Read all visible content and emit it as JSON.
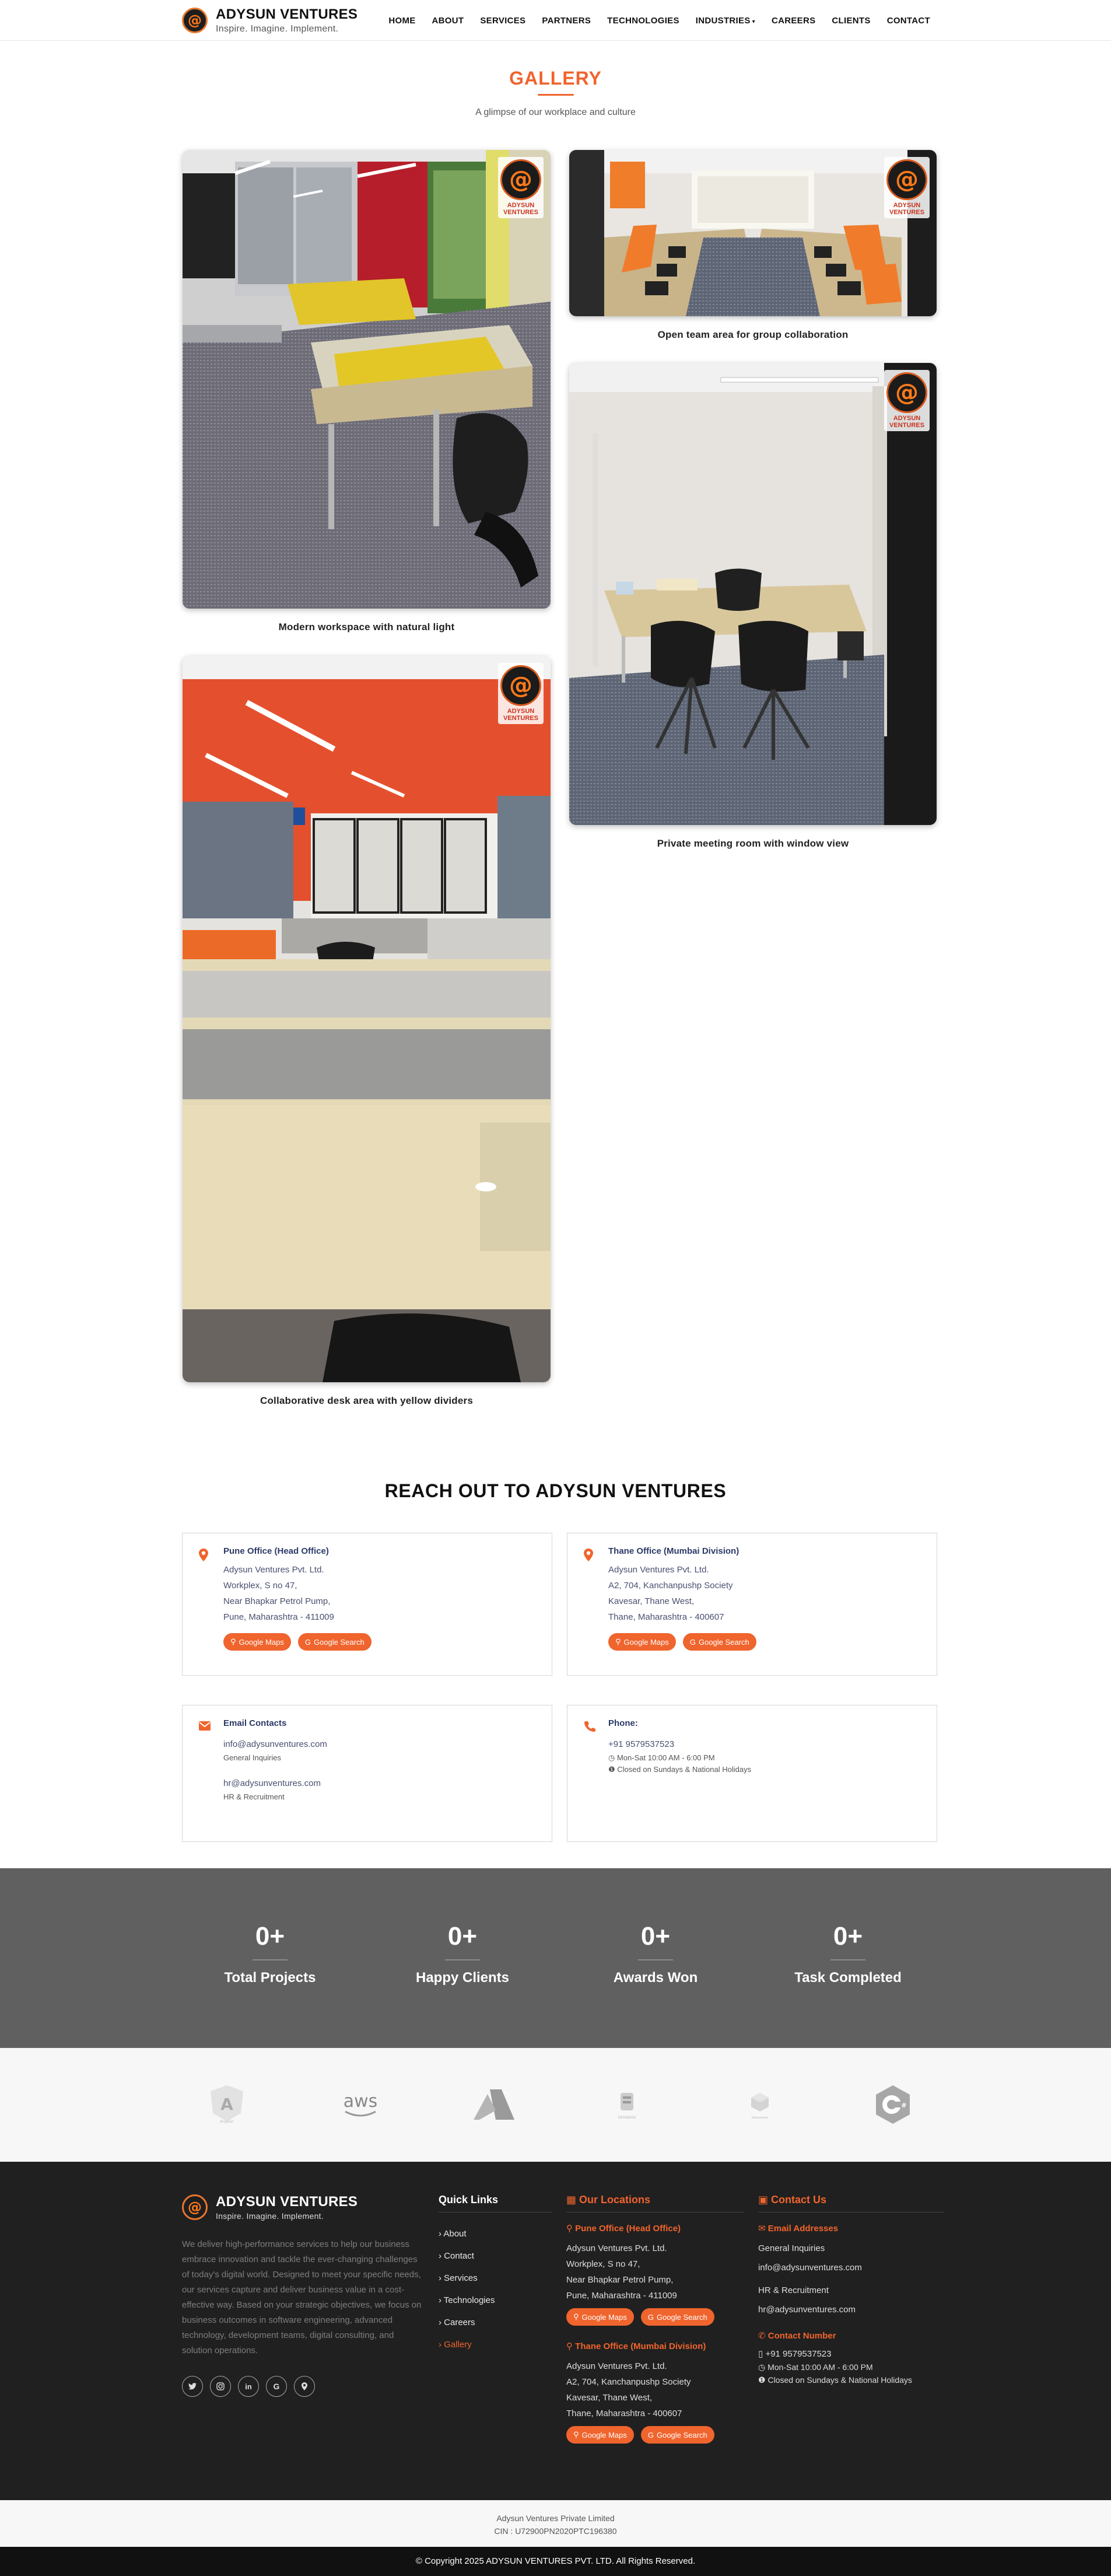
{
  "brand": {
    "name": "ADYSUN VENTURES",
    "tagline": "Inspire. Imagine. Implement.",
    "logo_glyph": "@"
  },
  "nav": [
    {
      "label": "HOME"
    },
    {
      "label": "ABOUT"
    },
    {
      "label": "SERVICES"
    },
    {
      "label": "PARTNERS"
    },
    {
      "label": "TECHNOLOGIES"
    },
    {
      "label": "INDUSTRIES",
      "dropdown": true
    },
    {
      "label": "CAREERS"
    },
    {
      "label": "CLIENTS"
    },
    {
      "label": "CONTACT"
    }
  ],
  "gallery": {
    "title": "GALLERY",
    "subtitle": "A glimpse of our workplace and culture",
    "badge_text": "ADYSUN\nVENTURES",
    "items": [
      {
        "caption": "Modern workspace with natural light"
      },
      {
        "caption": "Open team area for group collaboration"
      },
      {
        "caption": "Collaborative desk area with yellow dividers"
      },
      {
        "caption": "Private meeting room with window view"
      }
    ]
  },
  "reach": {
    "title": "REACH OUT TO ADYSUN VENTURES",
    "pune": {
      "title": "Pune Office (Head Office)",
      "lines": [
        "Adysun Ventures Pvt. Ltd.",
        "Workplex, S no 47,",
        "Near Bhapkar Petrol Pump,",
        "Pune, Maharashtra - 411009"
      ],
      "maps": "Google Maps",
      "search": "Google Search"
    },
    "thane": {
      "title": "Thane Office (Mumbai Division)",
      "lines": [
        "Adysun Ventures Pvt. Ltd.",
        "A2, 704, Kanchanpushp Society",
        "Kavesar, Thane West,",
        "Thane, Maharashtra - 400607"
      ],
      "maps": "Google Maps",
      "search": "Google Search"
    },
    "email": {
      "title": "Email Contacts",
      "general_email": "info@adysunventures.com",
      "general_label": "General Inquiries",
      "hr_email": "hr@adysunventures.com",
      "hr_label": "HR & Recruitment"
    },
    "phone": {
      "title": "Phone:",
      "number": "+91 9579537523",
      "hours": "Mon-Sat 10:00 AM - 6:00 PM",
      "closed": "Closed on Sundays & National Holidays"
    }
  },
  "stats": [
    {
      "value": "0+",
      "label": "Total Projects"
    },
    {
      "value": "0+",
      "label": "Happy Clients"
    },
    {
      "value": "0+",
      "label": "Awards Won"
    },
    {
      "value": "0+",
      "label": "Task Completed"
    }
  ],
  "tech_logos": [
    {
      "name": "angular-logo",
      "text": "Angular"
    },
    {
      "name": "aws-logo",
      "text": "aws"
    },
    {
      "name": "azure-logo",
      "text": ""
    },
    {
      "name": "database-logo",
      "text": "DATABASE"
    },
    {
      "name": "cube-logo",
      "text": "Kubernetes"
    },
    {
      "name": "csharp-logo",
      "text": "C#"
    }
  ],
  "footer": {
    "description": "We deliver high-performance services to help our business embrace innovation and tackle the ever-changing challenges of today's digital world. Designed to meet your specific needs, our services capture and deliver business value in a cost-effective way. Based on your strategic objectives, we focus on business outcomes in software engineering, advanced technology, development teams, digital consulting, and solution operations.",
    "quick_links_title": "Quick Links",
    "quick_links": [
      "About",
      "Contact",
      "Services",
      "Technologies",
      "Careers",
      "Gallery"
    ],
    "locations_title": "Our Locations",
    "pune_title": "Pune Office (Head Office)",
    "pune_lines": [
      "Adysun Ventures Pvt. Ltd.",
      "Workplex, S no 47,",
      "Near Bhapkar Petrol Pump,",
      "Pune, Maharashtra - 411009"
    ],
    "thane_title": "Thane Office (Mumbai Division)",
    "thane_lines": [
      "Adysun Ventures Pvt. Ltd.",
      "A2, 704, Kanchanpushp Society",
      "Kavesar, Thane West,",
      "Thane, Maharashtra - 400607"
    ],
    "maps": "Google Maps",
    "search": "Google Search",
    "contact_title": "Contact Us",
    "email_title": "Email Addresses",
    "general_label": "General Inquiries",
    "general_email": "info@adysunventures.com",
    "hr_label": "HR & Recruitment",
    "hr_email": "hr@adysunventures.com",
    "number_title": "Contact Number",
    "number": "+91 9579537523",
    "hours": "Mon-Sat 10:00 AM - 6:00 PM",
    "closed": "Closed on Sundays & National Holidays",
    "company": "Adysun Ventures Private Limited",
    "cin": "CIN : U72900PN2020PTC196380",
    "copyright": "© Copyright 2025 ADYSUN VENTURES PVT. LTD. All Rights Reserved."
  },
  "colors": {
    "accent": "#f0642d",
    "footer_bg": "#202020",
    "stats_bg": "#606060",
    "heading_blue": "#2b3a67"
  }
}
